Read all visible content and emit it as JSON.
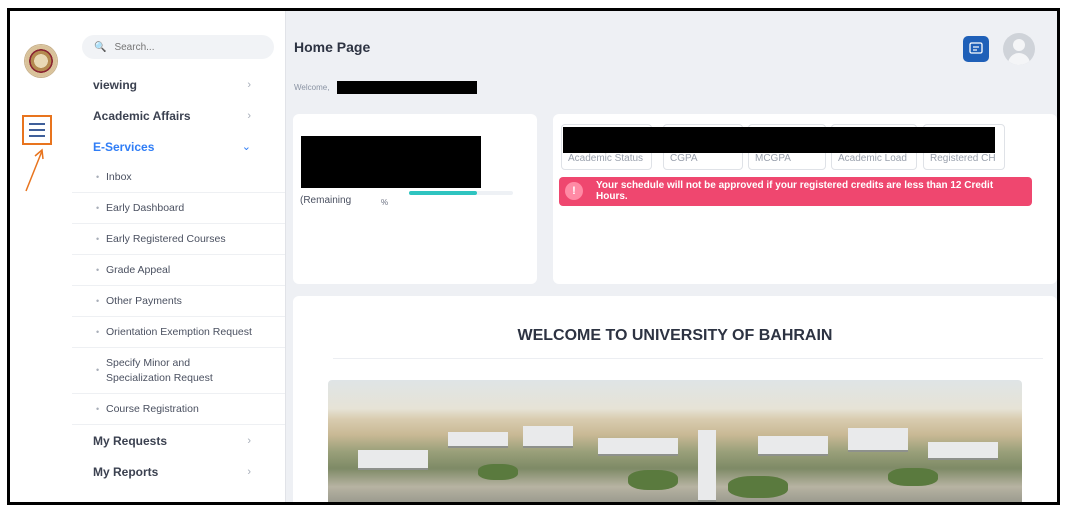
{
  "search": {
    "placeholder": "Search..."
  },
  "sidebar": {
    "items": [
      {
        "label": "viewing"
      },
      {
        "label": "Academic Affairs"
      },
      {
        "label": "E-Services"
      },
      {
        "label": "My Requests"
      },
      {
        "label": "My Reports"
      }
    ],
    "eservices": [
      {
        "label": "Inbox"
      },
      {
        "label": "Early Dashboard"
      },
      {
        "label": "Early Registered Courses"
      },
      {
        "label": "Grade Appeal"
      },
      {
        "label": "Other Payments"
      },
      {
        "label": "Orientation Exemption Request"
      },
      {
        "label": "Specify Minor and Specialization Request"
      },
      {
        "label": "Course Registration"
      }
    ]
  },
  "header": {
    "title": "Home Page",
    "welcome": "Welcome,"
  },
  "progress_card": {
    "remaining_label": "(Remaining",
    "percent_symbol": "%",
    "progress_fill_fraction": 0.65
  },
  "stats": {
    "academic_status": "Academic Status",
    "cgpa": "CGPA",
    "mcgpa": "MCGPA",
    "academic_load": "Academic Load",
    "registered_ch": "Registered CH"
  },
  "alert": {
    "icon": "!",
    "message": "Your schedule will not be approved if your registered credits are less than 12 Credit Hours."
  },
  "welcome_banner": {
    "title": "WELCOME TO UNIVERSITY OF BAHRAIN"
  },
  "colors": {
    "accent": "#2f7df6",
    "alert": "#ef476f",
    "progress": "#2ec4c0",
    "highlight": "#e8741e",
    "chat_button": "#1f60b8"
  },
  "icons": {
    "logo": "university-logo",
    "menu": "hamburger-icon",
    "search": "search-icon",
    "chat": "chat-icon",
    "avatar": "user-avatar-icon"
  }
}
